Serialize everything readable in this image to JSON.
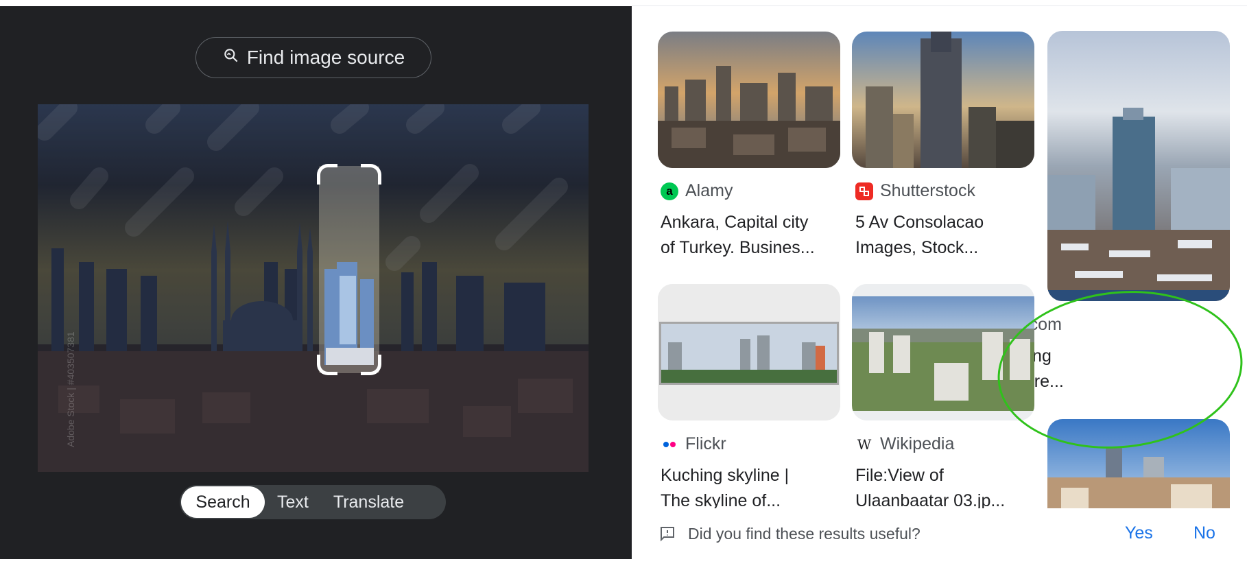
{
  "lens": {
    "find_source_label": "Find image source",
    "query_watermark": "Adobe Stock | #403507381",
    "tabs": [
      {
        "label": "Search",
        "active": true
      },
      {
        "label": "Text",
        "active": false
      },
      {
        "label": "Translate",
        "active": false
      }
    ]
  },
  "results": [
    {
      "source": "Alamy",
      "favicon": "alamy-icon",
      "favicon_letter": "a",
      "favicon_color": "#00c853",
      "title_line1": "Ankara, Capital city",
      "title_line2": "of Turkey. Busines..."
    },
    {
      "source": "Shutterstock",
      "favicon": "shutterstock-icon",
      "favicon_letter": "",
      "favicon_color": "#ee2b24",
      "title_line1": "5 Av Consolacao",
      "title_line2": "Images, Stock..."
    },
    {
      "source": "Dreamstime.com",
      "favicon": "dreamstime-icon",
      "favicon_letter": "",
      "favicon_color": "#e91e63",
      "title_line1": "Baskanligi Building",
      "title_line2": "Stock Photos - Fre..."
    },
    {
      "source": "Flickr",
      "favicon": "flickr-icon",
      "favicon_letter": "",
      "favicon_color": "#ff0084",
      "title_line1": "Kuching skyline |",
      "title_line2": "The skyline of..."
    },
    {
      "source": "Wikipedia",
      "favicon": "wikipedia-icon",
      "favicon_letter": "W",
      "favicon_color": "#000000",
      "title_line1": "File:View of",
      "title_line2": "Ulaanbaatar 03.jp..."
    }
  ],
  "feedback": {
    "question": "Did you find these results useful?",
    "yes_label": "Yes",
    "no_label": "No"
  },
  "colors": {
    "panel_bg": "#202124",
    "link_blue": "#1a73e8",
    "highlight_green": "#2fc21b"
  }
}
